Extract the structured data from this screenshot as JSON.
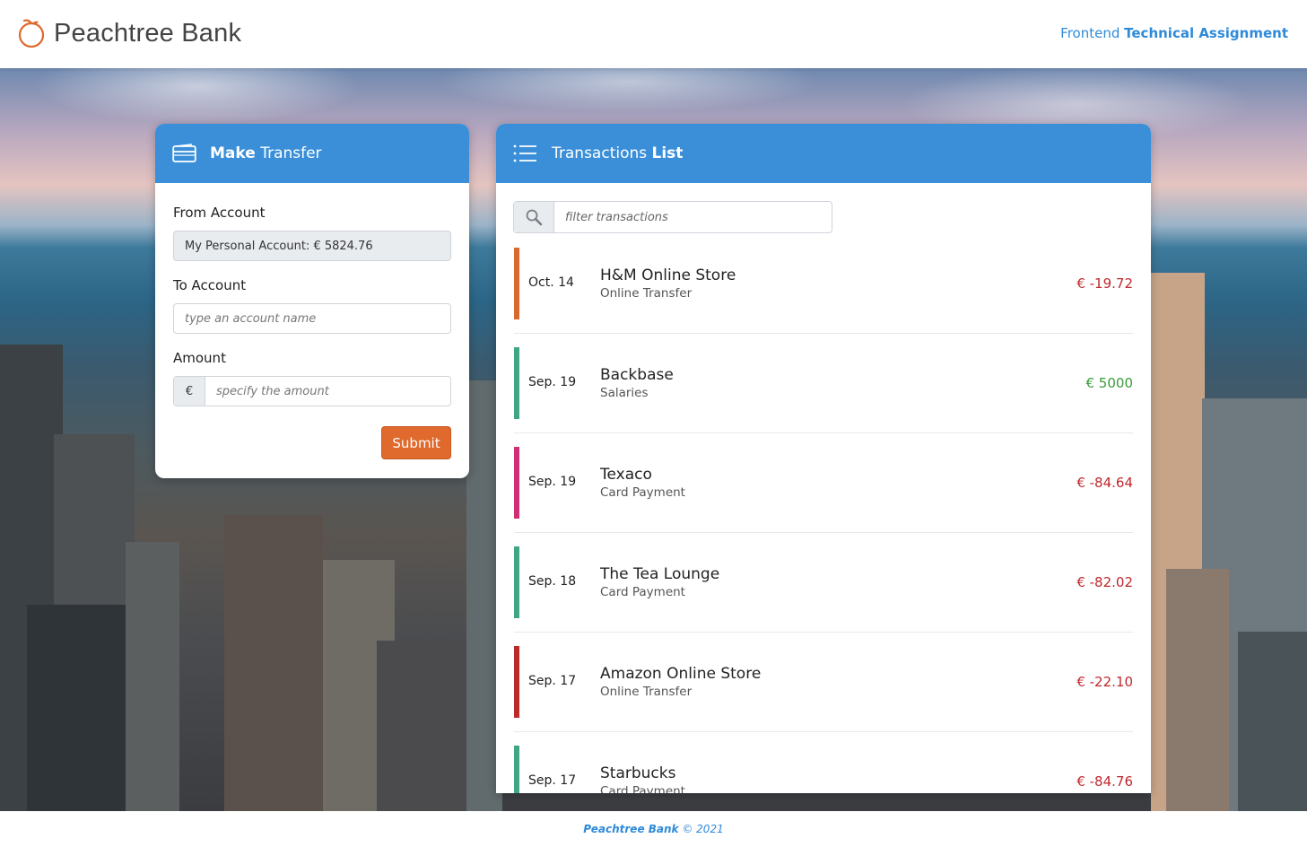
{
  "header": {
    "brand": "Peachtree Bank",
    "assignment_prefix": "Frontend",
    "assignment_bold": "Technical Assignment"
  },
  "transfer": {
    "title_bold": "Make",
    "title_rest": "Transfer",
    "from_label": "From Account",
    "from_value": "My Personal Account: € 5824.76",
    "to_label": "To Account",
    "to_placeholder": "type an account name",
    "amount_label": "Amount",
    "currency_symbol": "€",
    "amount_placeholder": "specify the amount",
    "submit_label": "Submit"
  },
  "transactions": {
    "title_rest": "Transactions",
    "title_bold": "List",
    "filter_placeholder": "filter transactions",
    "items": [
      {
        "date": "Oct. 14",
        "merchant": "H&M Online Store",
        "type": "Online Transfer",
        "amount": "€ -19.72",
        "category_color": "#d9692f",
        "amount_color": "#c0272d"
      },
      {
        "date": "Sep. 19",
        "merchant": "Backbase",
        "type": "Salaries",
        "amount": "€ 5000",
        "category_color": "#3fa585",
        "amount_color": "#3a9a3a"
      },
      {
        "date": "Sep. 19",
        "merchant": "Texaco",
        "type": "Card Payment",
        "amount": "€ -84.64",
        "category_color": "#cf2f73",
        "amount_color": "#c0272d"
      },
      {
        "date": "Sep. 18",
        "merchant": "The Tea Lounge",
        "type": "Card Payment",
        "amount": "€ -82.02",
        "category_color": "#3fa585",
        "amount_color": "#c0272d"
      },
      {
        "date": "Sep. 17",
        "merchant": "Amazon Online Store",
        "type": "Online Transfer",
        "amount": "€ -22.10",
        "category_color": "#bb2b2b",
        "amount_color": "#c0272d"
      },
      {
        "date": "Sep. 17",
        "merchant": "Starbucks",
        "type": "Card Payment",
        "amount": "€ -84.76",
        "category_color": "#3fa585",
        "amount_color": "#c0272d"
      }
    ]
  },
  "footer": {
    "brand": "Peachtree Bank",
    "copyright": "© 2021"
  },
  "icons": {
    "logo": "peach-icon",
    "transfer": "credit-card-icon",
    "list": "list-icon",
    "search": "search-icon"
  }
}
